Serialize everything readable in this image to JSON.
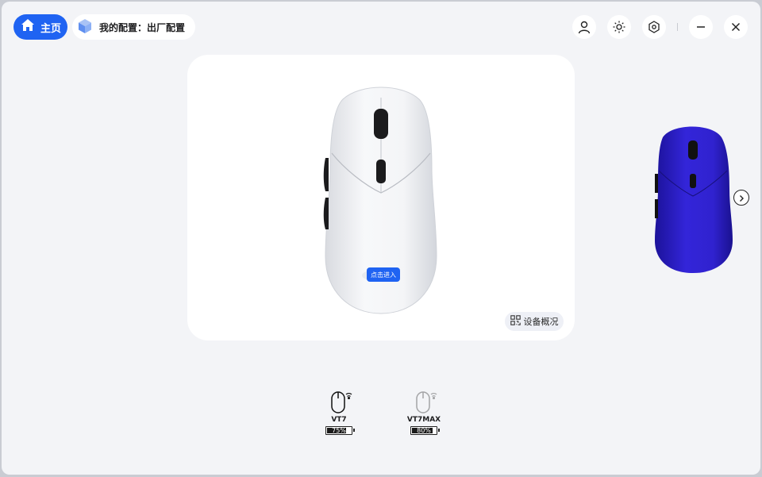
{
  "header": {
    "home_label": "主页",
    "config_label": "我的配置：出厂配置"
  },
  "top_icons": [
    "user-icon",
    "brightness-icon",
    "settings-icon",
    "minimize-icon",
    "close-icon"
  ],
  "main_card": {
    "enter_label": "点击进入",
    "overview_label": "设备概况"
  },
  "colors": {
    "accent": "#1f63f2",
    "background": "#f3f4f7",
    "blue_mouse": "#2b1fc7"
  },
  "devices": [
    {
      "name": "VT7",
      "battery_text": "75%",
      "battery_level": 0.75,
      "active": true
    },
    {
      "name": "VT7MAX",
      "battery_text": "80%",
      "battery_level": 0.8,
      "active": false
    }
  ]
}
